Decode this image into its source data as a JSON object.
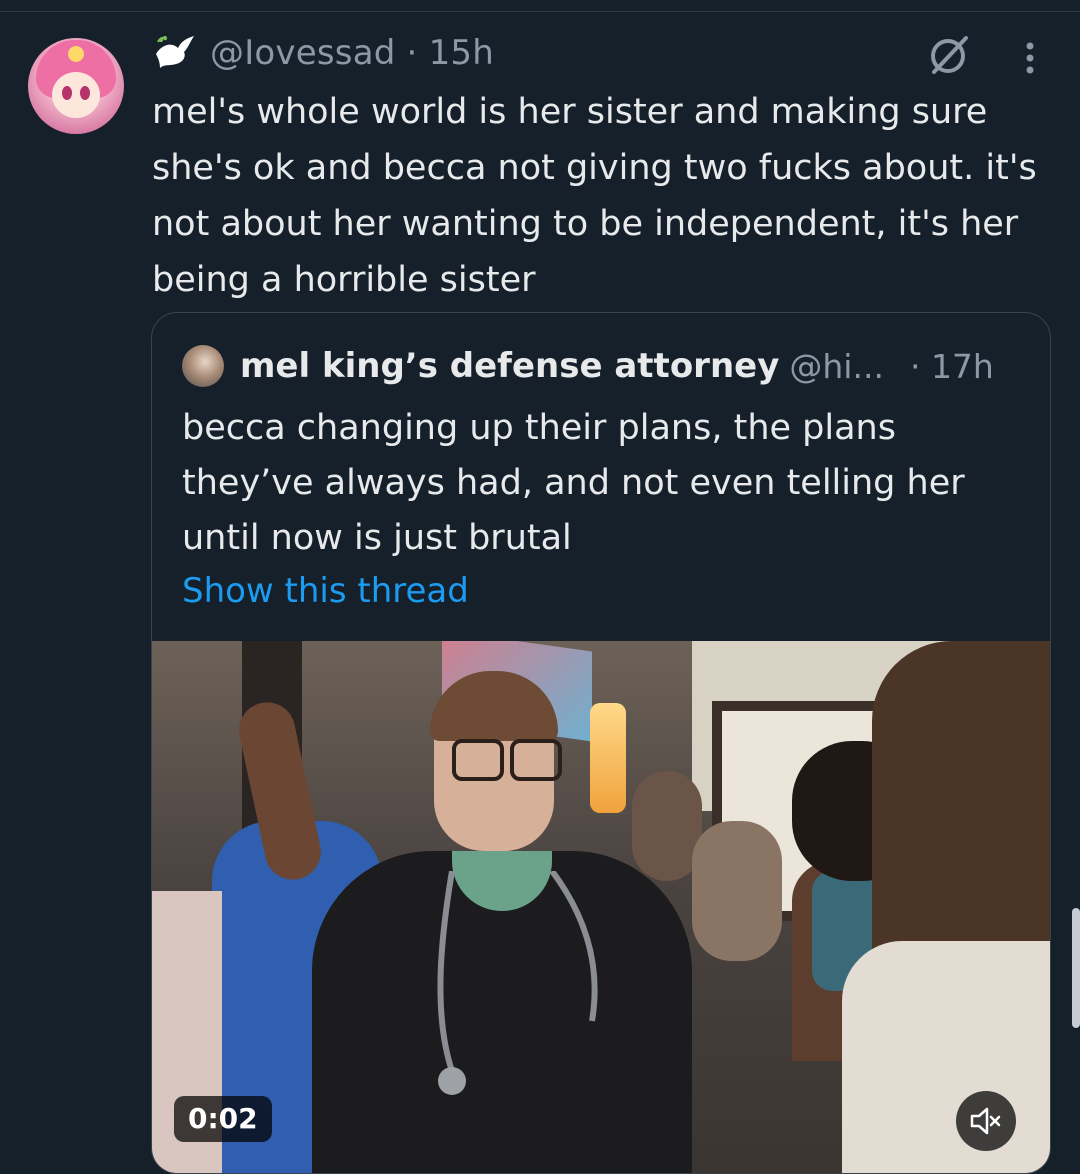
{
  "tweet": {
    "handle": "@Iovessad",
    "separator": "·",
    "time": "15h",
    "text": "mel's whole world is her sister and making sure she's ok and becca not giving two fucks about. it's not about her wanting to be independent, it's her being a horrible sister",
    "icons": {
      "badge": "dove-icon",
      "grok": "grok-icon",
      "more": "more-icon"
    }
  },
  "quoted_tweet": {
    "name": "mel king’s defense attorney",
    "handle": "@hi...",
    "separator": "·",
    "time": "17h",
    "text": "becca changing up their plans, the plans they’ve always had, and not even telling her until now is just brutal",
    "show_thread": "Show this thread",
    "video": {
      "timestamp": "0:02",
      "mute_icon": "volume-muted-icon"
    }
  },
  "colors": {
    "background": "#15202b",
    "text": "#e7e9ea",
    "secondary_text": "#8b98a5",
    "link": "#1d9bf0",
    "border": "#38444d"
  }
}
